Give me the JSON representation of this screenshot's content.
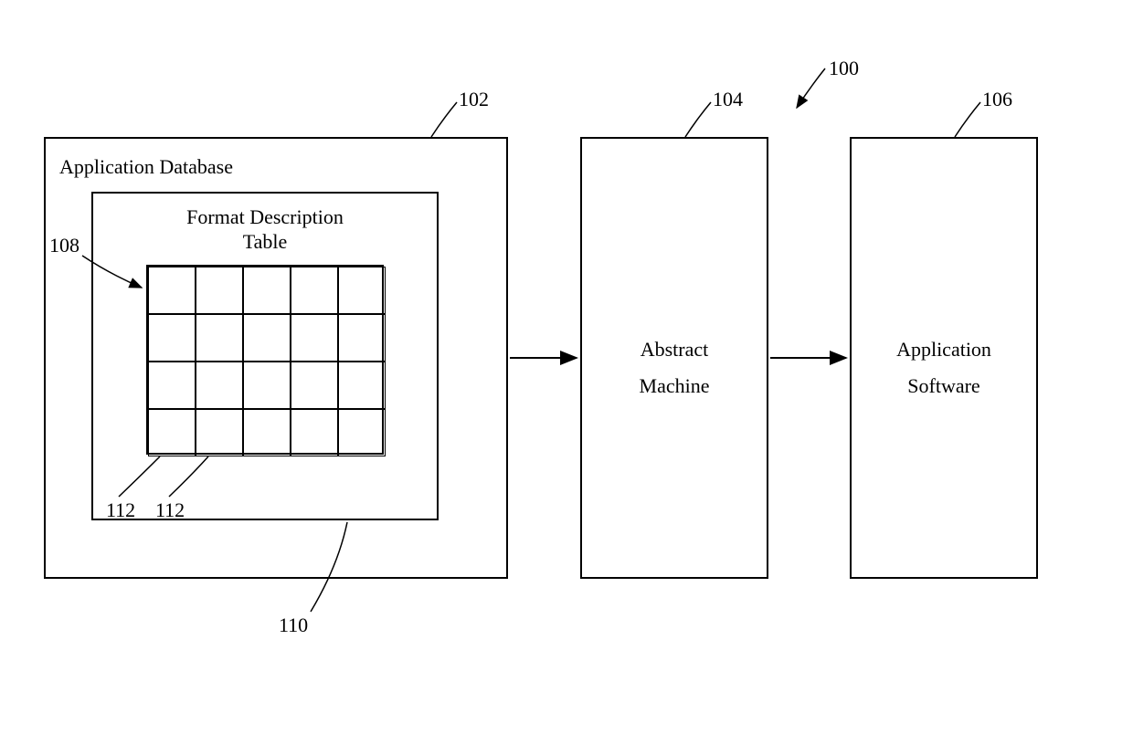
{
  "refs": {
    "system": "100",
    "database": "102",
    "abstractMachine": "104",
    "appSoftware": "106",
    "formatTable": "108",
    "innerBox": "110",
    "cell1": "112",
    "cell2": "112"
  },
  "labels": {
    "database": "Application Database",
    "formatTableLine1": "Format Description",
    "formatTableLine2": "Table",
    "abstractLine1": "Abstract",
    "machineLine2": "Machine",
    "appLine1": "Application",
    "softwareLine2": "Software"
  }
}
